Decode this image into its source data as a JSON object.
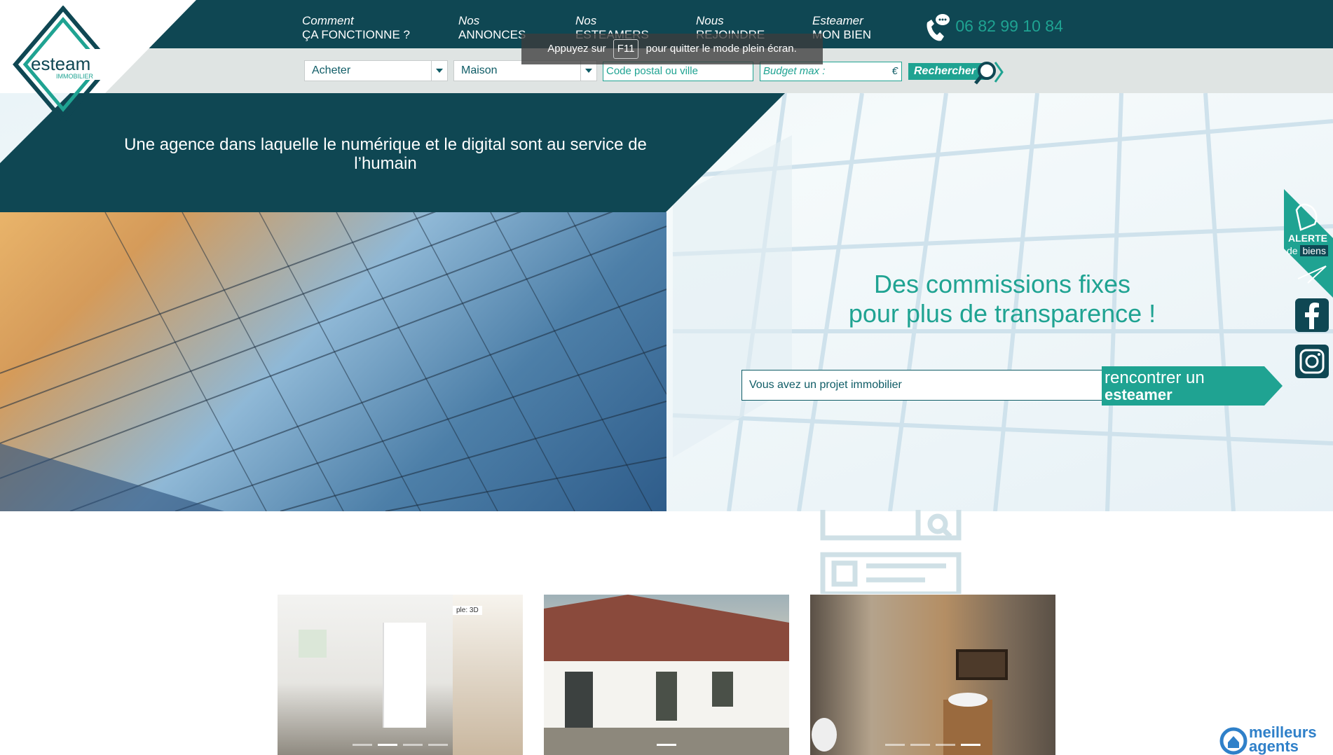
{
  "brand": {
    "logo_main": "esteam",
    "logo_sub": "IMMOBILIER"
  },
  "nav": [
    {
      "line1": "Comment",
      "line2": "ÇA FONCTIONNE ?"
    },
    {
      "line1": "Nos",
      "line2": "ANNONCES"
    },
    {
      "line1": "Nos",
      "line2": "ESTEAMERS"
    },
    {
      "line1": "Nous",
      "line2": "REJOINDRE"
    },
    {
      "line1": "Esteamer",
      "line2": "MON BIEN"
    }
  ],
  "phone": "06 82 99 10 84",
  "search": {
    "transaction_value": "Acheter",
    "type_value": "Maison",
    "location_placeholder": "Code postal ou ville",
    "budget_placeholder": "Budget max :",
    "currency": "€",
    "button_label": "Rechercher"
  },
  "fullscreen_toast": {
    "before": "Appuyez sur",
    "key": "F11",
    "after": "pour quitter le mode plein écran."
  },
  "hero": {
    "tagline": "Une agence dans laquelle le numérique et le digital sont au service de l’humain",
    "headline_line1": "Des commissions fixes",
    "headline_line2": "pour plus de transparence !",
    "project_placeholder": "Vous avez un projet immobilier",
    "meet_line1": "rencontrer un",
    "meet_line2": "esteamer"
  },
  "side": {
    "alert_line1": "ALERTE",
    "alert_de": "de",
    "alert_biens": "biens",
    "facebook_icon": "facebook-icon",
    "instagram_icon": "instagram-icon"
  },
  "cards": [
    {
      "image": "empty-apartment-room-photo",
      "label_3d": "ple: 3D",
      "dots": 4,
      "active": 1
    },
    {
      "image": "house-exterior-photo",
      "dots": 1,
      "active": 0
    },
    {
      "image": "stone-bathroom-photo",
      "dots": 4,
      "active": 3
    }
  ],
  "partner": {
    "line1": "meilleurs",
    "line2": "agents"
  },
  "colors": {
    "primary_dark": "#0f4753",
    "accent_teal": "#1fa392",
    "search_band": "#dfe4e3"
  }
}
